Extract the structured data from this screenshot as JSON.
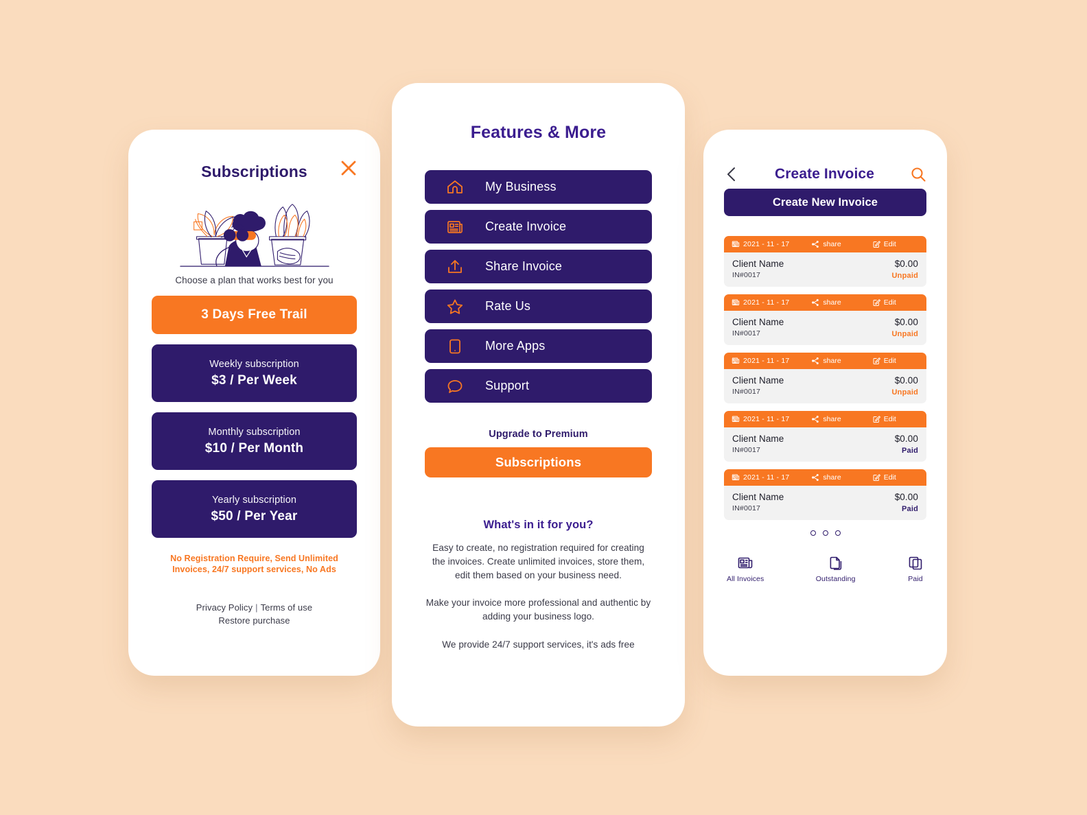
{
  "theme": {
    "background": "#fadcbe",
    "card": "#ffffff",
    "primary": "#2f1b6b",
    "primary_title": "#3b1d8f",
    "accent": "#f87722",
    "muted_row": "#f2f2f2"
  },
  "subscriptions": {
    "title": "Subscriptions",
    "close_icon": "close-icon",
    "illustration": "person-with-binoculars-illustration",
    "subtitle": "Choose a plan that works best for you",
    "trial_label": "3 Days Free Trail",
    "plans": [
      {
        "name": "Weekly subscription",
        "price": "$3 / Per Week"
      },
      {
        "name": "Monthly subscription",
        "price": "$10 / Per Month"
      },
      {
        "name": "Yearly subscription",
        "price": "$50 / Per Year"
      }
    ],
    "note_line1": "No Registration Require, Send Unlimited",
    "note_line2": "Invoices, 24/7 support services, No Ads",
    "privacy_policy": "Privacy Policy",
    "separator": "|",
    "terms_of_use": "Terms of use",
    "restore_purchase": "Restore purchase"
  },
  "features": {
    "title": "Features & More",
    "items": [
      {
        "label": "My Business",
        "icon": "home-icon"
      },
      {
        "label": "Create Invoice",
        "icon": "newspaper-icon"
      },
      {
        "label": "Share Invoice",
        "icon": "upload-icon"
      },
      {
        "label": "Rate Us",
        "icon": "star-icon"
      },
      {
        "label": "More Apps",
        "icon": "app-tile-icon"
      },
      {
        "label": "Support",
        "icon": "chat-bubble-icon"
      }
    ],
    "upgrade_label": "Upgrade to Premium",
    "subscriptions_button": "Subscriptions",
    "whats_title": "What's in it for you?",
    "paragraphs": [
      "Easy to create, no registration required for creating the invoices. Create unlimited invoices, store them, edit them based on your business need.",
      "Make your invoice more professional and authentic by adding your business logo.",
      "We provide 24/7 support services, it's ads free"
    ]
  },
  "invoices": {
    "back_icon": "chevron-left-icon",
    "title": "Create Invoice",
    "search_icon": "search-icon",
    "create_button": "Create New Invoice",
    "bar_labels": {
      "share": "share",
      "edit": "Edit"
    },
    "bar_icons": {
      "date": "newspaper-icon",
      "share": "share-icon",
      "edit": "edit-pencil-icon"
    },
    "rows": [
      {
        "date": "2021 - 11 - 17",
        "client": "Client Name",
        "number": "IN#0017",
        "amount": "$0.00",
        "status": "Unpaid",
        "status_kind": "unpaid"
      },
      {
        "date": "2021 - 11 - 17",
        "client": "Client Name",
        "number": "IN#0017",
        "amount": "$0.00",
        "status": "Unpaid",
        "status_kind": "unpaid"
      },
      {
        "date": "2021 - 11 - 17",
        "client": "Client Name",
        "number": "IN#0017",
        "amount": "$0.00",
        "status": "Unpaid",
        "status_kind": "unpaid"
      },
      {
        "date": "2021 - 11 - 17",
        "client": "Client Name",
        "number": "IN#0017",
        "amount": "$0.00",
        "status": "Paid",
        "status_kind": "paid"
      },
      {
        "date": "2021 - 11 - 17",
        "client": "Client Name",
        "number": "IN#0017",
        "amount": "$0.00",
        "status": "Paid",
        "status_kind": "paid"
      }
    ],
    "pager_dots": 3,
    "bottom_nav": [
      {
        "label": "All Invoices",
        "icon": "newspaper-icon"
      },
      {
        "label": "Outstanding",
        "icon": "copy-pages-icon"
      },
      {
        "label": "Paid",
        "icon": "stacked-pages-icon"
      }
    ]
  }
}
